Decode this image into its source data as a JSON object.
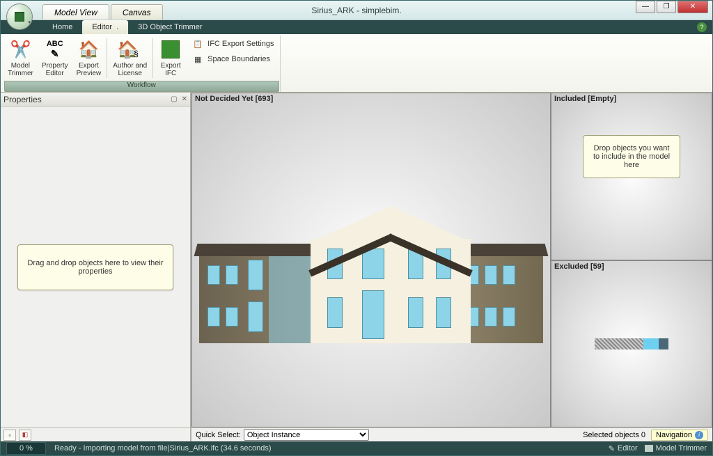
{
  "window": {
    "title": "Sirius_ARK - simplebim.",
    "top_tabs": [
      "Model View",
      "Canvas"
    ],
    "active_top_tab": 0
  },
  "menubar": {
    "items": [
      "Home",
      "Editor",
      "3D Object Trimmer"
    ],
    "active": 1
  },
  "ribbon": {
    "group_label": "Workflow",
    "buttons": [
      {
        "label": "Model\nTrimmer"
      },
      {
        "label": "Property\nEditor"
      },
      {
        "label": "Export\nPreview"
      },
      {
        "label": "Author and\nLicense"
      },
      {
        "label": "Export\nIFC"
      }
    ],
    "side_items": [
      "IFC Export Settings",
      "Space Boundaries"
    ]
  },
  "properties": {
    "title": "Properties",
    "hint": "Drag and drop objects here to view their properties"
  },
  "viewports": {
    "main": "Not Decided Yet [693]",
    "included": "Included [Empty]",
    "included_hint": "Drop objects you want to include in the model here",
    "excluded": "Excluded [59]"
  },
  "quickselect": {
    "label": "Quick Select:",
    "value": "Object Instance",
    "selected_label": "Selected objects 0",
    "nav_label": "Navigation"
  },
  "status": {
    "pct": "0 %",
    "msg": "Ready - Importing model from file|Sirius_ARK.ifc  (34.6 seconds)",
    "right": [
      "Editor",
      "Model Trimmer"
    ]
  }
}
